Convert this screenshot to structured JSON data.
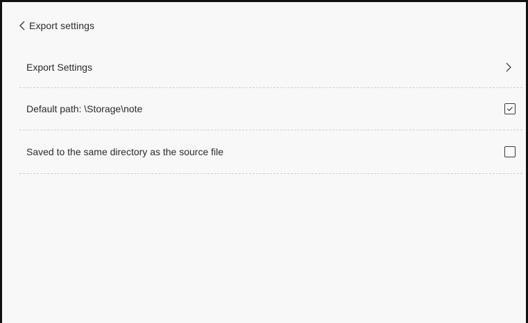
{
  "header": {
    "back_icon": "chevron-left-icon",
    "title": "Export settings"
  },
  "rows": [
    {
      "label": "Export Settings",
      "control": "chevron-right-icon"
    },
    {
      "label": "Default path: \\Storage\\note",
      "control": "checkbox",
      "checked": true
    },
    {
      "label": "Saved to the same directory as the source file",
      "control": "checkbox",
      "checked": false
    }
  ],
  "colors": {
    "background": "#f8f8f8",
    "text": "#2b2b2b",
    "divider": "#cfcfcf",
    "border": "#111111"
  }
}
